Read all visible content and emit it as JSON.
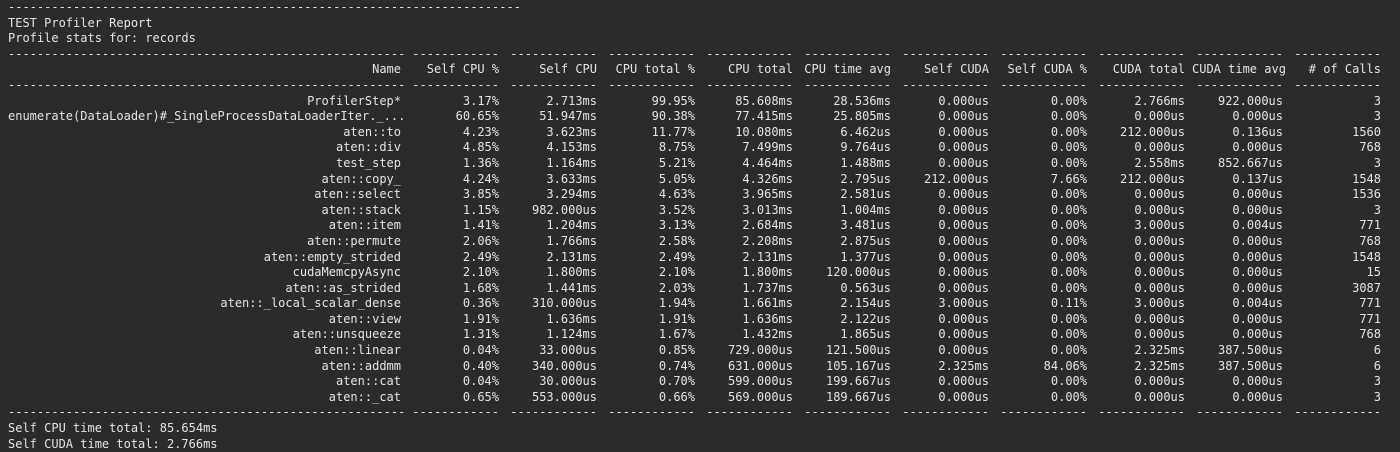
{
  "report": {
    "top_rule": "-----------------------------------------------------------------------",
    "title": "TEST Profiler Report",
    "subtitle": "Profile stats for: records"
  },
  "dashes": {
    "name": "-------------------------------------------------------",
    "col": "------------"
  },
  "columns": [
    "Name",
    "Self CPU %",
    "Self CPU",
    "CPU total %",
    "CPU total",
    "CPU time avg",
    "Self CUDA",
    "Self CUDA %",
    "CUDA total",
    "CUDA time avg",
    "# of Calls"
  ],
  "rows": [
    [
      "ProfilerStep*",
      "3.17%",
      "2.713ms",
      "99.95%",
      "85.608ms",
      "28.536ms",
      "0.000us",
      "0.00%",
      "2.766ms",
      "922.000us",
      "3"
    ],
    [
      "enumerate(DataLoader)#_SingleProcessDataLoaderIter._...",
      "60.65%",
      "51.947ms",
      "90.38%",
      "77.415ms",
      "25.805ms",
      "0.000us",
      "0.00%",
      "0.000us",
      "0.000us",
      "3"
    ],
    [
      "aten::to",
      "4.23%",
      "3.623ms",
      "11.77%",
      "10.080ms",
      "6.462us",
      "0.000us",
      "0.00%",
      "212.000us",
      "0.136us",
      "1560"
    ],
    [
      "aten::div",
      "4.85%",
      "4.153ms",
      "8.75%",
      "7.499ms",
      "9.764us",
      "0.000us",
      "0.00%",
      "0.000us",
      "0.000us",
      "768"
    ],
    [
      "test_step",
      "1.36%",
      "1.164ms",
      "5.21%",
      "4.464ms",
      "1.488ms",
      "0.000us",
      "0.00%",
      "2.558ms",
      "852.667us",
      "3"
    ],
    [
      "aten::copy_",
      "4.24%",
      "3.633ms",
      "5.05%",
      "4.326ms",
      "2.795us",
      "212.000us",
      "7.66%",
      "212.000us",
      "0.137us",
      "1548"
    ],
    [
      "aten::select",
      "3.85%",
      "3.294ms",
      "4.63%",
      "3.965ms",
      "2.581us",
      "0.000us",
      "0.00%",
      "0.000us",
      "0.000us",
      "1536"
    ],
    [
      "aten::stack",
      "1.15%",
      "982.000us",
      "3.52%",
      "3.013ms",
      "1.004ms",
      "0.000us",
      "0.00%",
      "0.000us",
      "0.000us",
      "3"
    ],
    [
      "aten::item",
      "1.41%",
      "1.204ms",
      "3.13%",
      "2.684ms",
      "3.481us",
      "0.000us",
      "0.00%",
      "3.000us",
      "0.004us",
      "771"
    ],
    [
      "aten::permute",
      "2.06%",
      "1.766ms",
      "2.58%",
      "2.208ms",
      "2.875us",
      "0.000us",
      "0.00%",
      "0.000us",
      "0.000us",
      "768"
    ],
    [
      "aten::empty_strided",
      "2.49%",
      "2.131ms",
      "2.49%",
      "2.131ms",
      "1.377us",
      "0.000us",
      "0.00%",
      "0.000us",
      "0.000us",
      "1548"
    ],
    [
      "cudaMemcpyAsync",
      "2.10%",
      "1.800ms",
      "2.10%",
      "1.800ms",
      "120.000us",
      "0.000us",
      "0.00%",
      "0.000us",
      "0.000us",
      "15"
    ],
    [
      "aten::as_strided",
      "1.68%",
      "1.441ms",
      "2.03%",
      "1.737ms",
      "0.563us",
      "0.000us",
      "0.00%",
      "0.000us",
      "0.000us",
      "3087"
    ],
    [
      "aten::_local_scalar_dense",
      "0.36%",
      "310.000us",
      "1.94%",
      "1.661ms",
      "2.154us",
      "3.000us",
      "0.11%",
      "3.000us",
      "0.004us",
      "771"
    ],
    [
      "aten::view",
      "1.91%",
      "1.636ms",
      "1.91%",
      "1.636ms",
      "2.122us",
      "0.000us",
      "0.00%",
      "0.000us",
      "0.000us",
      "771"
    ],
    [
      "aten::unsqueeze",
      "1.31%",
      "1.124ms",
      "1.67%",
      "1.432ms",
      "1.865us",
      "0.000us",
      "0.00%",
      "0.000us",
      "0.000us",
      "768"
    ],
    [
      "aten::linear",
      "0.04%",
      "33.000us",
      "0.85%",
      "729.000us",
      "121.500us",
      "0.000us",
      "0.00%",
      "2.325ms",
      "387.500us",
      "6"
    ],
    [
      "aten::addmm",
      "0.40%",
      "340.000us",
      "0.74%",
      "631.000us",
      "105.167us",
      "2.325ms",
      "84.06%",
      "2.325ms",
      "387.500us",
      "6"
    ],
    [
      "aten::cat",
      "0.04%",
      "30.000us",
      "0.70%",
      "599.000us",
      "199.667us",
      "0.000us",
      "0.00%",
      "0.000us",
      "0.000us",
      "3"
    ],
    [
      "aten::_cat",
      "0.65%",
      "553.000us",
      "0.66%",
      "569.000us",
      "189.667us",
      "0.000us",
      "0.00%",
      "0.000us",
      "0.000us",
      "3"
    ]
  ],
  "footer": {
    "self_cpu": "Self CPU time total: 85.654ms",
    "self_cuda": "Self CUDA time total: 2.766ms"
  }
}
